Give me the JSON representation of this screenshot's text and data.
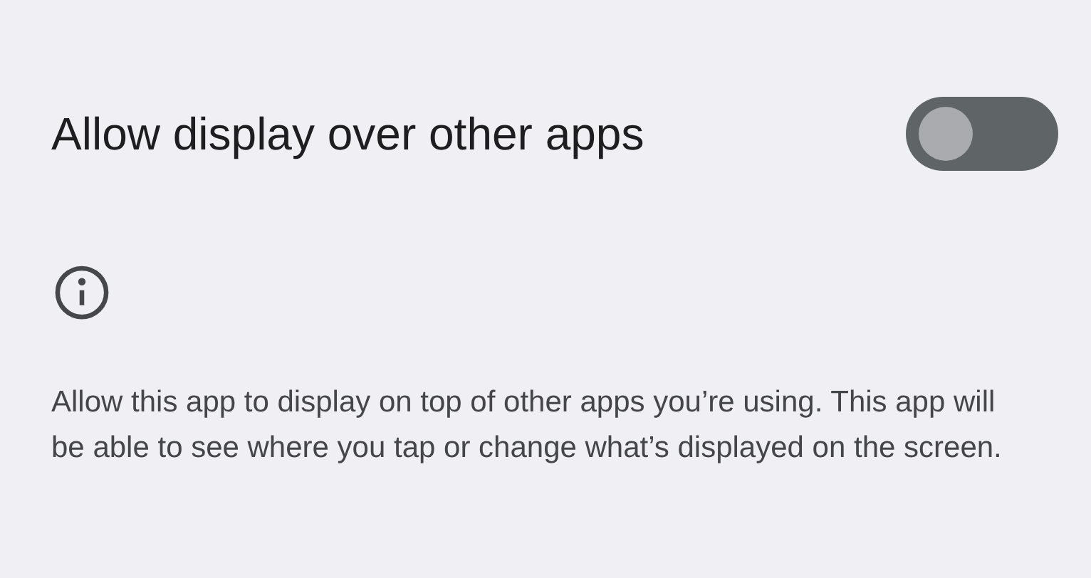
{
  "setting": {
    "title": "Allow display over other apps",
    "on": false
  },
  "description": "Allow this app to display on top of other apps you’re using. This app will be able to see where you tap or change what’s displayed on the screen."
}
